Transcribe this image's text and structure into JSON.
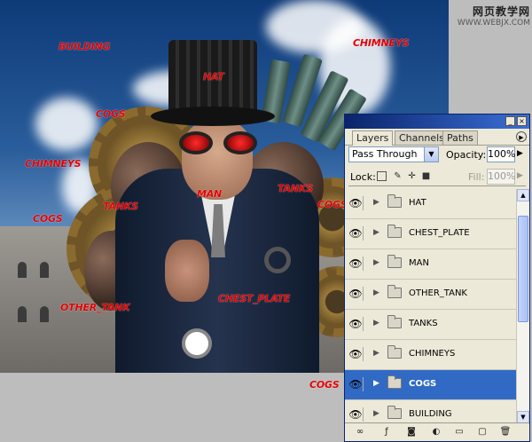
{
  "watermark": {
    "line1": "网页教学网",
    "line2": "WWW.WEBJX.COM"
  },
  "canvas": {
    "annotations": [
      {
        "name": "building",
        "text": "BUILDING"
      },
      {
        "name": "hat",
        "text": "HAT"
      },
      {
        "name": "chimneys-top",
        "text": "CHIMNEYS"
      },
      {
        "name": "cogs-upper",
        "text": "COGS"
      },
      {
        "name": "chimneys-left",
        "text": "CHIMNEYS"
      },
      {
        "name": "man",
        "text": "MAN"
      },
      {
        "name": "tanks-right",
        "text": "TANKS"
      },
      {
        "name": "tanks-left",
        "text": "TANKS"
      },
      {
        "name": "cogs-left",
        "text": "COGS"
      },
      {
        "name": "cogs-right",
        "text": "COGS"
      },
      {
        "name": "chest-plate",
        "text": "CHEST_PLATE"
      },
      {
        "name": "other-tank",
        "text": "OTHER_TANK"
      },
      {
        "name": "cogs-bottom",
        "text": "COGS"
      }
    ]
  },
  "layers_panel": {
    "tabs": [
      "Layers",
      "Channels",
      "Paths"
    ],
    "active_tab": "Layers",
    "blend_mode": "Pass Through",
    "opacity_label": "Opacity:",
    "opacity_value": "100%",
    "lock_label": "Lock:",
    "fill_label": "Fill:",
    "fill_value": "100%",
    "layers": [
      {
        "name": "HAT",
        "visible": true,
        "selected": false
      },
      {
        "name": "CHEST_PLATE",
        "visible": true,
        "selected": false
      },
      {
        "name": "MAN",
        "visible": true,
        "selected": false
      },
      {
        "name": "OTHER_TANK",
        "visible": true,
        "selected": false
      },
      {
        "name": "TANKS",
        "visible": true,
        "selected": false
      },
      {
        "name": "CHIMNEYS",
        "visible": true,
        "selected": false
      },
      {
        "name": "COGS",
        "visible": true,
        "selected": true
      },
      {
        "name": "BUILDING",
        "visible": true,
        "selected": false
      }
    ],
    "selection_color": "#316ac5"
  }
}
